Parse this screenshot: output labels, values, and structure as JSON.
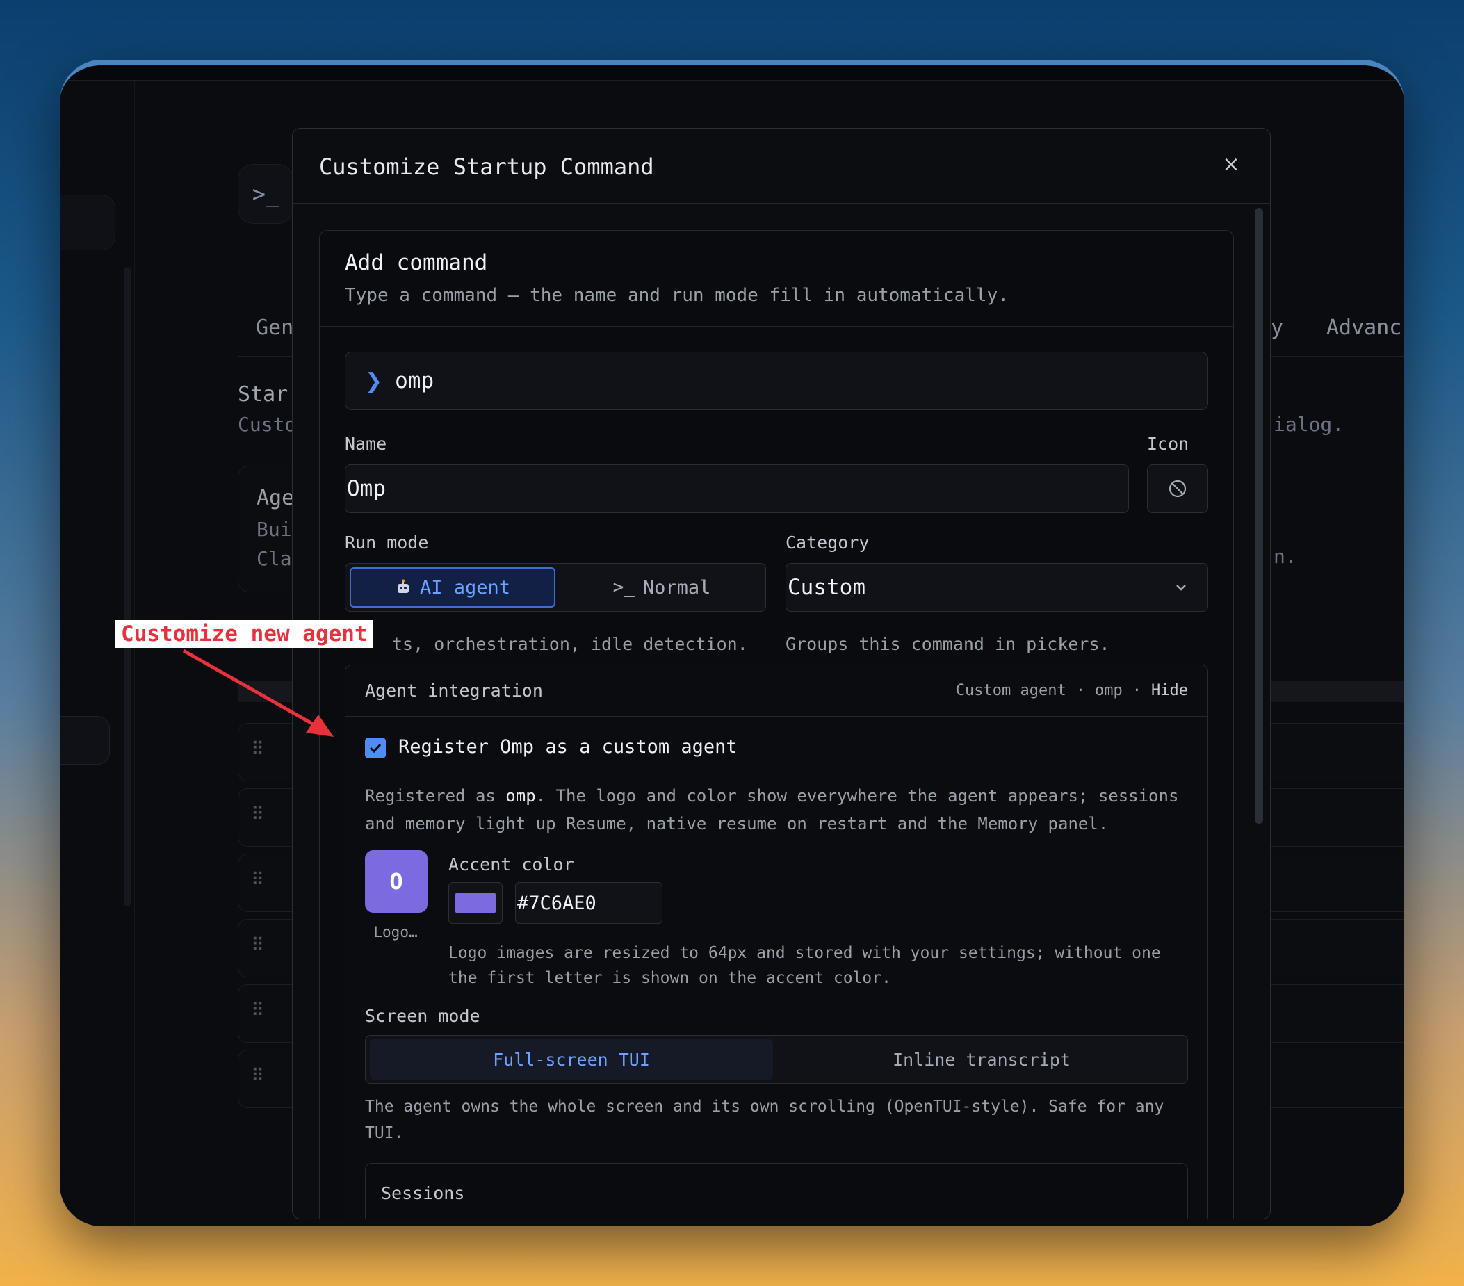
{
  "background": {
    "term_glyph": ">_",
    "tabs_left": "Gen",
    "tabs_right_1": "y",
    "tabs_right_2": "Advanc",
    "section_title": "Star",
    "section_sub": "Custo",
    "section_sub_right": "ialog.",
    "card_title": "Age",
    "card_line1": "Bui",
    "card_line2": "Cla",
    "card_right": "n."
  },
  "modal": {
    "title": "Customize Startup Command",
    "close_label": "×"
  },
  "add_command": {
    "title": "Add command",
    "subtitle": "Type a command — the name and run mode fill in automatically.",
    "command_prefix": "❯",
    "command_value": "omp"
  },
  "name_field": {
    "label": "Name",
    "value": "Omp"
  },
  "icon_field": {
    "label": "Icon",
    "icon": "no-icon-circle-slash"
  },
  "run_mode": {
    "label": "Run mode",
    "options": [
      {
        "label": "AI agent",
        "icon": "robot-icon",
        "selected": true
      },
      {
        "label": "Normal",
        "icon": "terminal-icon",
        "glyph": ">_",
        "selected": false
      }
    ],
    "helper": "ts, orchestration, idle detection."
  },
  "category": {
    "label": "Category",
    "value": "Custom",
    "helper": "Groups this command in pickers."
  },
  "agent_integration": {
    "title": "Agent integration",
    "meta_1": "Custom agent",
    "separator": "·",
    "meta_2": "omp",
    "hide_label": "Hide",
    "register_checked": true,
    "register_label": "Register Omp as a custom agent",
    "desc_pre": "Registered as ",
    "desc_id": "omp",
    "desc_post": ". The logo and color show everywhere the agent appears; sessions and memory light up Resume, native resume on restart and the Memory panel.",
    "logo_letter": "O",
    "logo_caption": "Logo…",
    "accent_label": "Accent color",
    "accent_hex": "#7C6AE0",
    "logo_note": "Logo images are resized to 64px and stored with your settings; without one the first letter is shown on the accent color.",
    "screen_mode_label": "Screen mode",
    "screen_modes": [
      {
        "label": "Full-screen TUI",
        "selected": true
      },
      {
        "label": "Inline transcript",
        "selected": false
      }
    ],
    "screen_desc": "The agent owns the whole screen and its own scrolling (OpenTUI-style). Safe for any TUI.",
    "sessions_title": "Sessions"
  },
  "annotation": {
    "text": "Customize new agent",
    "color": "#e8313a"
  }
}
